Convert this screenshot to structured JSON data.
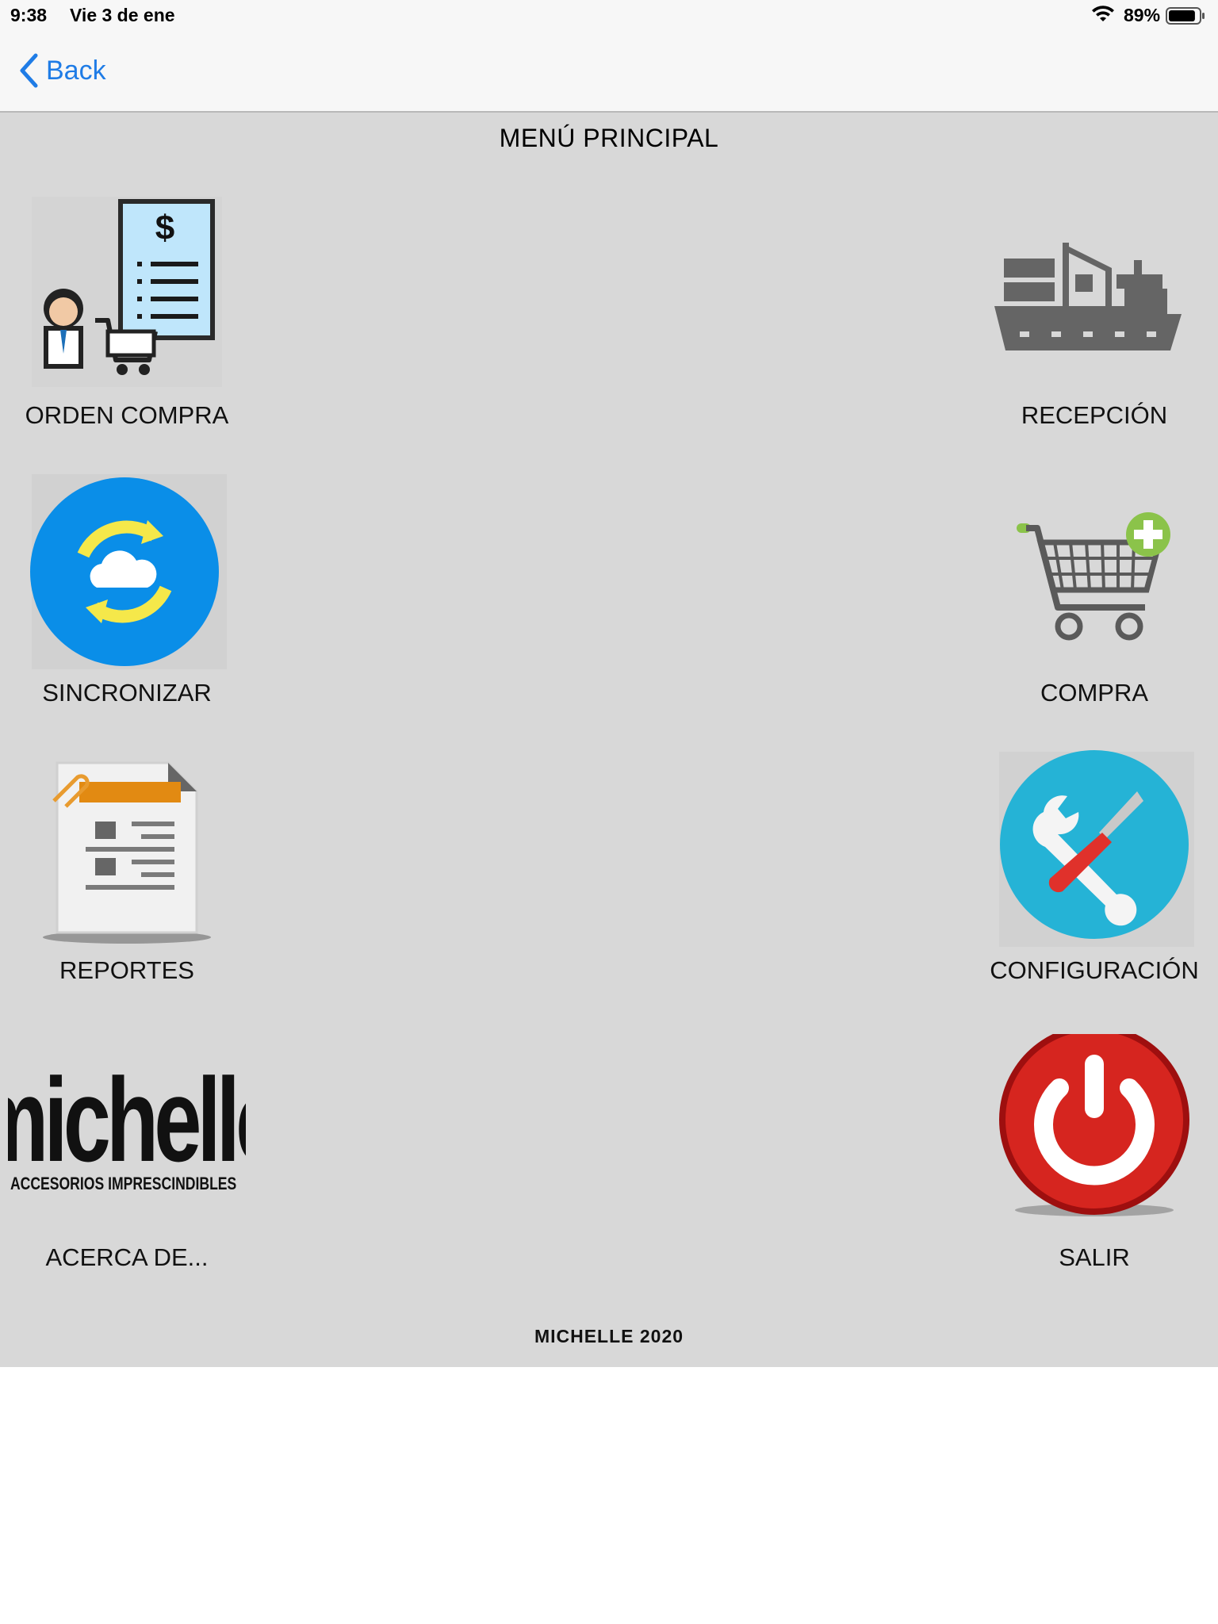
{
  "status_bar": {
    "time": "9:38",
    "date": "Vie 3 de ene",
    "battery_percent": "89%",
    "battery_level": 0.89,
    "icons": [
      "wifi-icon",
      "battery-icon"
    ]
  },
  "navbar": {
    "back_label": "Back",
    "back_icon": "chevron-left-icon",
    "accent_color": "#1f7ce6"
  },
  "main": {
    "title": "MENÚ PRINCIPAL",
    "background_color": "#d8d8d8",
    "menu_items": [
      {
        "label": "ORDEN COMPRA",
        "icon": "purchase-order-icon"
      },
      {
        "label": "RECEPCIÓN",
        "icon": "cargo-ship-icon"
      },
      {
        "label": "SINCRONIZAR",
        "icon": "sync-cloud-icon"
      },
      {
        "label": "COMPRA",
        "icon": "add-to-cart-icon"
      },
      {
        "label": "REPORTES",
        "icon": "report-document-icon"
      },
      {
        "label": "CONFIGURACIÓN",
        "icon": "tools-icon"
      },
      {
        "label": "ACERCA DE...",
        "icon": "michelle-logo"
      },
      {
        "label": "SALIR",
        "icon": "power-icon"
      }
    ],
    "logo": {
      "brand": "michelle",
      "tagline": "ACCESORIOS IMPRESCINDIBLES"
    },
    "footer": "MICHELLE 2020"
  }
}
